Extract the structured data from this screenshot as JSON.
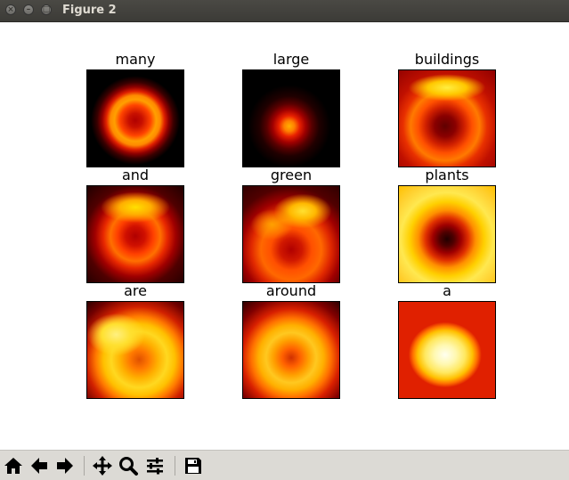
{
  "window": {
    "title": "Figure 2",
    "controls": [
      "close",
      "minimize",
      "maximize"
    ]
  },
  "panels": [
    {
      "label": "many",
      "pattern": "ring"
    },
    {
      "label": "large",
      "pattern": "center-spot"
    },
    {
      "label": "buildings",
      "pattern": "top-bright-with-dark-center"
    },
    {
      "label": "and",
      "pattern": "ring-top-bright"
    },
    {
      "label": "green",
      "pattern": "top-bright-arc"
    },
    {
      "label": "plants",
      "pattern": "bright-with-dark-center"
    },
    {
      "label": "are",
      "pattern": "bright-ring"
    },
    {
      "label": "around",
      "pattern": "bright-ring"
    },
    {
      "label": "a",
      "pattern": "bright-center-blob"
    }
  ],
  "colormap": "hot",
  "toolbar": {
    "buttons": [
      "home-icon",
      "back-arrow-icon",
      "forward-arrow-icon",
      "pan-icon",
      "zoom-icon",
      "configure-subplots-icon",
      "save-icon"
    ]
  }
}
